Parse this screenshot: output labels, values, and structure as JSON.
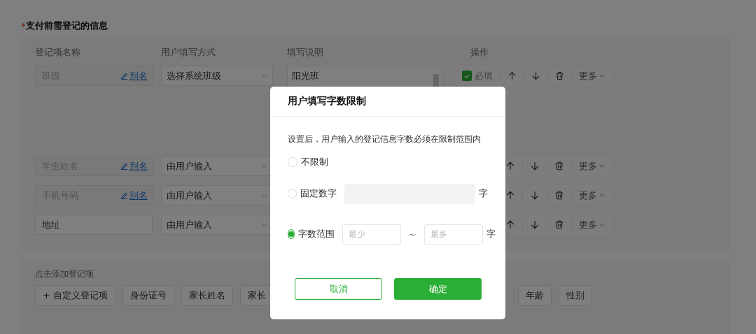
{
  "section": {
    "required_mark": "*",
    "title": "支付前需登记的信息"
  },
  "table": {
    "columns": [
      "登记项名称",
      "用户填写方式",
      "填写说明",
      "操作"
    ],
    "rows": [
      {
        "name": "班级",
        "name_editable": false,
        "alias_link": "别名",
        "fill_mode": "选择系统班级",
        "description_lines": [
          "阳光班"
        ],
        "required": true,
        "required_label": "必填",
        "more": "更多"
      },
      {
        "name": "学生姓名",
        "name_editable": false,
        "alias_link": "别名",
        "fill_mode": "由用户输入",
        "more": "更多"
      },
      {
        "name": "手机号码",
        "name_editable": false,
        "alias_link": "别名",
        "fill_mode": "由用户输入",
        "more": "更多"
      },
      {
        "name": "地址",
        "name_editable": true,
        "fill_mode": "由用户输入",
        "more": "更多"
      }
    ]
  },
  "add_items": {
    "label": "点击添加登记项",
    "chips_before_dialog": [
      "+ 自定义登记项",
      "身份证号",
      "家长姓名",
      "家长"
    ],
    "chips_after_dialog": [
      "年龄",
      "性别"
    ]
  },
  "dialog": {
    "title": "用户填写字数限制",
    "hint": "设置后，用户输入的登记信息字数必须在限制范围内",
    "options": [
      {
        "kind": "none",
        "label": "不限制",
        "selected": false
      },
      {
        "kind": "fixed",
        "label": "固定数字",
        "selected": false,
        "input_disabled": true,
        "unit": "字"
      },
      {
        "kind": "range",
        "label": "字数范围",
        "selected": true,
        "min_placeholder": "最少",
        "separator": "~",
        "max_placeholder": "最多",
        "unit": "字"
      }
    ],
    "buttons": [
      {
        "kind": "secondary",
        "label": "取消"
      },
      {
        "kind": "primary",
        "label": "确定"
      }
    ]
  }
}
